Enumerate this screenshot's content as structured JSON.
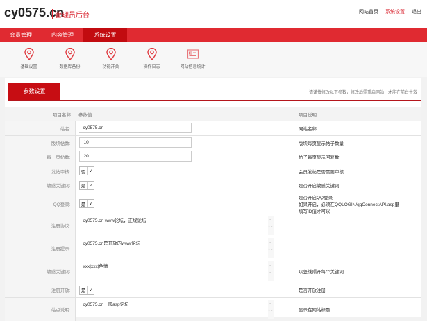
{
  "header": {
    "logo": "cy0575.cn",
    "subtitle": "管理员后台",
    "links": [
      "网站首页",
      "系统设置",
      "退出"
    ]
  },
  "nav": [
    "会员管理",
    "内容管理",
    "系统设置"
  ],
  "subnav": [
    {
      "label": "基础设置",
      "icon": "location-pin-icon"
    },
    {
      "label": "数据库备份",
      "icon": "location-pin-icon"
    },
    {
      "label": "功能开关",
      "icon": "location-pin-icon"
    },
    {
      "label": "操作日志",
      "icon": "location-pin-icon"
    },
    {
      "label": "网站信息统计",
      "icon": "id-card-icon"
    }
  ],
  "tab": "参数设置",
  "note": "请谨慎修改以下参数，修改后需重启网站，才能在前台生效",
  "table": {
    "headers": [
      "项目名称",
      "参数值",
      "项目说明"
    ],
    "rows": [
      {
        "label": "站名:",
        "value": "cy0575.cn",
        "desc": "网站名称"
      },
      {
        "label": "版块帖数:",
        "value": "10",
        "desc": "版块每页显示帖子数量"
      },
      {
        "label": "每一页帖数:",
        "value": "20",
        "desc": "帖子每页显示回复数"
      },
      {
        "label": "发帖审核:",
        "value": "否",
        "desc": "会员发帖是否需要审核"
      },
      {
        "label": "敏感关键词:",
        "value": "是",
        "desc": "是否开启敏感关键词"
      },
      {
        "label": "QQ登录:",
        "value": "是",
        "desc": "是否开启QQ登录",
        "desc2": "如果开启，必须在QQLOGIN/qqConnectAPI.asp里填写ID值才可以"
      },
      {
        "label": "注册协议:",
        "value": "cy0575.cn www论坛，正规论坛"
      },
      {
        "label": "注册提示:",
        "value": "cy0575.cn是开放的www论坛"
      },
      {
        "label": "敏感关键词:",
        "value": "xxx|xxx|色情",
        "desc": "以竖线隔开每个关键词"
      },
      {
        "label": "注册开放:",
        "value": "是",
        "desc": "是否开放注册"
      },
      {
        "label": "站点说明:",
        "value": "cy0575.cn一般asp论坛",
        "desc": "显示在网站标题"
      }
    ]
  }
}
